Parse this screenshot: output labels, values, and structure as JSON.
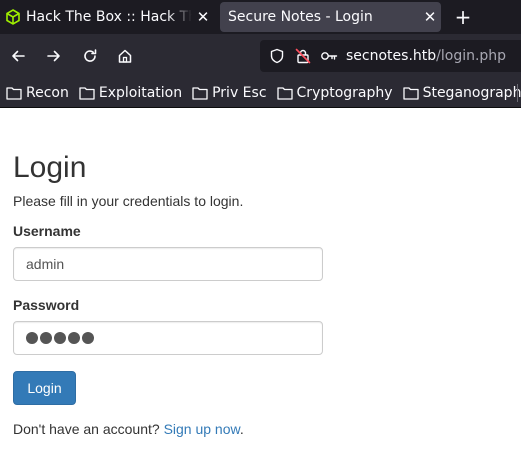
{
  "browser": {
    "tabs": [
      {
        "title": "Hack The Box :: Hack The Box",
        "icon": "htb-cube-icon",
        "active": false
      },
      {
        "title": "Secure Notes - Login",
        "icon": "",
        "active": true
      }
    ],
    "tab_close": "✕",
    "new_tab": "+",
    "url_host": "secnotes.htb",
    "url_path": "/login.php",
    "bookmarks": [
      "Recon",
      "Exploitation",
      "Priv Esc",
      "Cryptography",
      "Steganography"
    ],
    "colors": {
      "tabbar": "#1c1b22",
      "toolbar": "#2b2a33",
      "active_tab": "#42414d",
      "htb_green": "#9fef00"
    }
  },
  "page": {
    "title": "Login",
    "intro": "Please fill in your credentials to login.",
    "username_label": "Username",
    "username_value": "admin",
    "password_label": "Password",
    "password_mask_count": 5,
    "login_button": "Login",
    "no_account_text": "Don't have an account?",
    "signup_link": "Sign up now",
    "signup_suffix": ".",
    "colors": {
      "primary": "#337ab7",
      "text": "#333333"
    }
  }
}
